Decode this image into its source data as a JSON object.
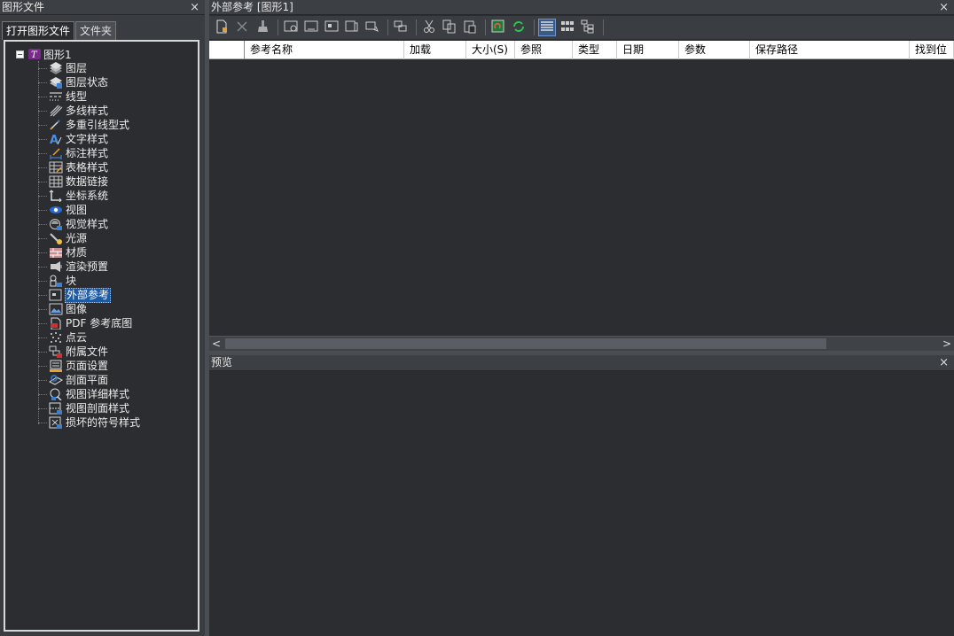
{
  "left_panel": {
    "title": "图形文件",
    "close": "×",
    "tabs": [
      {
        "label": "打开图形文件"
      },
      {
        "label": "文件夹"
      }
    ],
    "root": {
      "expander": "−",
      "label": "图形1"
    },
    "items": [
      {
        "label": "图层",
        "icon": "layer-icon"
      },
      {
        "label": "图层状态",
        "icon": "layer-state-icon"
      },
      {
        "label": "线型",
        "icon": "linetype-icon"
      },
      {
        "label": "多线样式",
        "icon": "mline-style-icon"
      },
      {
        "label": "多重引线型式",
        "icon": "mleader-style-icon"
      },
      {
        "label": "文字样式",
        "icon": "text-style-icon"
      },
      {
        "label": "标注样式",
        "icon": "dim-style-icon"
      },
      {
        "label": "表格样式",
        "icon": "table-style-icon"
      },
      {
        "label": "数据链接",
        "icon": "data-link-icon"
      },
      {
        "label": "坐标系统",
        "icon": "ucs-icon"
      },
      {
        "label": "视图",
        "icon": "view-icon"
      },
      {
        "label": "视觉样式",
        "icon": "visual-style-icon"
      },
      {
        "label": "光源",
        "icon": "light-icon"
      },
      {
        "label": "材质",
        "icon": "material-icon"
      },
      {
        "label": "渲染预置",
        "icon": "render-preset-icon"
      },
      {
        "label": "块",
        "icon": "block-icon"
      },
      {
        "label": "外部参考",
        "icon": "xref-icon",
        "selected": true
      },
      {
        "label": "图像",
        "icon": "image-icon"
      },
      {
        "label": "PDF 参考底图",
        "icon": "pdf-underlay-icon"
      },
      {
        "label": "点云",
        "icon": "point-cloud-icon"
      },
      {
        "label": "附属文件",
        "icon": "attached-file-icon"
      },
      {
        "label": "页面设置",
        "icon": "page-setup-icon"
      },
      {
        "label": "剖面平面",
        "icon": "section-plane-icon"
      },
      {
        "label": "视图详细样式",
        "icon": "detail-view-style-icon"
      },
      {
        "label": "视图剖面样式",
        "icon": "section-view-style-icon"
      },
      {
        "label": "损坏的符号样式",
        "icon": "broken-symbol-style-icon"
      }
    ]
  },
  "xref_panel": {
    "title": "外部参考 [图形1]",
    "close": "×",
    "columns": [
      "",
      "参考名称",
      "加载",
      "大小(S)",
      "参照",
      "类型",
      "日期",
      "参数",
      "保存路径",
      "找到位"
    ]
  },
  "preview_panel": {
    "title": "预览",
    "close": "×"
  },
  "scroll": {
    "left": "<",
    "right": ">"
  },
  "colors": {
    "background": "#2b2d30",
    "selection": "#1c5aa6",
    "panel_title": "#3c3f44"
  }
}
